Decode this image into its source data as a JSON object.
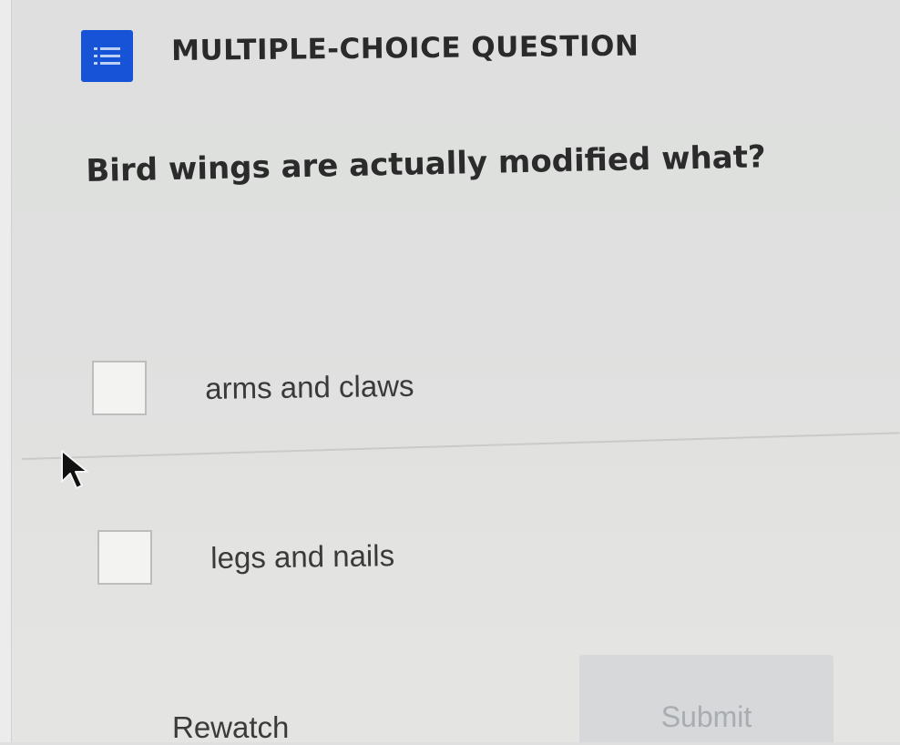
{
  "header": {
    "icon": "list-icon",
    "title": "MULTIPLE-CHOICE QUESTION",
    "icon_color": "#1753d6"
  },
  "question": {
    "text": "Bird wings are actually modified what?"
  },
  "options": [
    {
      "label": "arms and claws",
      "checked": false
    },
    {
      "label": "legs and nails",
      "checked": false
    }
  ],
  "footer": {
    "rewatch_label": "Rewatch",
    "submit_label": "Submit",
    "submit_enabled": false
  }
}
